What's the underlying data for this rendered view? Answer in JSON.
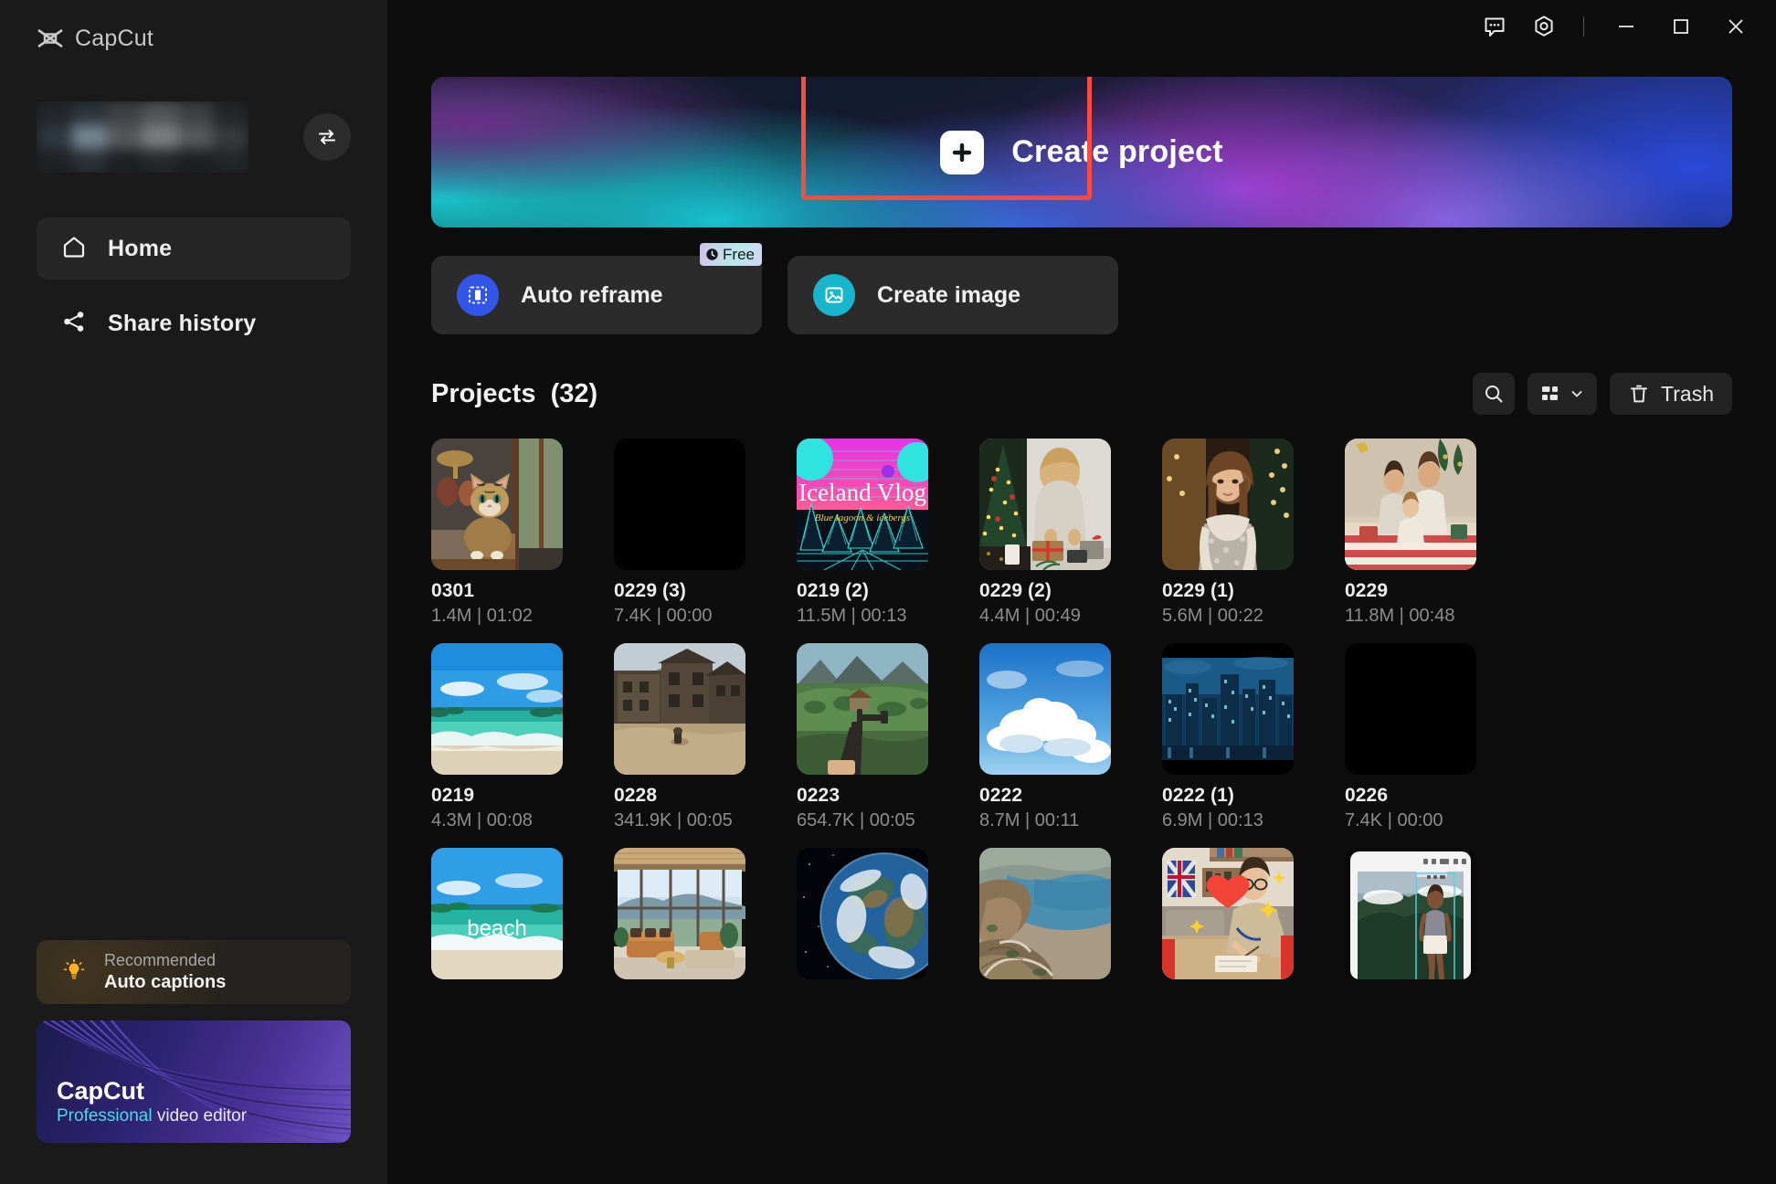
{
  "app": {
    "name": "CapCut"
  },
  "titlebar": {
    "feedback_icon": "speech-bubble-icon",
    "settings_icon": "gear-icon",
    "minimize_icon": "minimize-icon",
    "maximize_icon": "maximize-icon",
    "close_icon": "close-icon"
  },
  "sidebar": {
    "account": {
      "name_masked": "",
      "switch_icon": "switch-account-icon"
    },
    "nav": [
      {
        "label": "Home",
        "icon": "home-icon",
        "active": true
      },
      {
        "label": "Share history",
        "icon": "share-icon",
        "active": false
      }
    ],
    "recommended": {
      "icon": "lightbulb-icon",
      "subtitle": "Recommended",
      "title": "Auto captions"
    },
    "promo": {
      "title": "CapCut",
      "subtitle_accent": "Professional",
      "subtitle_rest": " video editor"
    }
  },
  "banner": {
    "create_label": "Create project",
    "plus_icon": "plus-icon",
    "highlight_color": "#fb4a3f"
  },
  "actions": [
    {
      "label": "Auto reframe",
      "icon": "auto-reframe-icon",
      "icon_color": "#3355e8",
      "badge": {
        "text": "Free",
        "icon": "clock-icon"
      }
    },
    {
      "label": "Create image",
      "icon": "image-icon",
      "icon_color": "#17b6cc",
      "badge": null
    }
  ],
  "projects_section": {
    "title": "Projects",
    "count": "(32)",
    "toolbar": {
      "search_icon": "search-icon",
      "view_icon": "grid-view-icon",
      "view_chevron_icon": "chevron-down-icon",
      "trash_icon": "trash-icon",
      "trash_label": "Trash"
    }
  },
  "projects": [
    {
      "title": "0301",
      "meta": "1.4M | 01:02",
      "thumb": "cat-window"
    },
    {
      "title": "0229 (3)",
      "meta": "7.4K | 00:00",
      "thumb": "black"
    },
    {
      "title": "0219 (2)",
      "meta": "11.5M | 00:13",
      "thumb": "iceland-vlog",
      "thumb_text": "Iceland Vlog",
      "thumb_subtext": "Blue lagoon & icebergs"
    },
    {
      "title": "0229 (2)",
      "meta": "4.4M | 00:49",
      "thumb": "christmas-gift-wrap"
    },
    {
      "title": "0229 (1)",
      "meta": "5.6M | 00:22",
      "thumb": "woman-christmas-lights"
    },
    {
      "title": "0229",
      "meta": "11.8M | 00:48",
      "thumb": "family-christmas"
    },
    {
      "title": "0219",
      "meta": "4.3M | 00:08",
      "thumb": "beach-sunny"
    },
    {
      "title": "0228",
      "meta": "341.9K | 00:05",
      "thumb": "game-village"
    },
    {
      "title": "0223",
      "meta": "654.7K | 00:05",
      "thumb": "game-valley-gun"
    },
    {
      "title": "0222",
      "meta": "8.7M | 00:11",
      "thumb": "clouds-sky"
    },
    {
      "title": "0222 (1)",
      "meta": "6.9M | 00:13",
      "thumb": "city-skyline"
    },
    {
      "title": "0226",
      "meta": "7.4K | 00:00",
      "thumb": "black"
    },
    {
      "title": "",
      "meta": "",
      "thumb": "beach-text",
      "thumb_text": "beach",
      "clipped": true
    },
    {
      "title": "",
      "meta": "",
      "thumb": "living-room",
      "clipped": true
    },
    {
      "title": "",
      "meta": "",
      "thumb": "earth-space",
      "clipped": true
    },
    {
      "title": "",
      "meta": "",
      "thumb": "coast-road",
      "clipped": true
    },
    {
      "title": "",
      "meta": "",
      "thumb": "woman-desk-heart",
      "clipped": true
    },
    {
      "title": "",
      "meta": "",
      "thumb": "editor-preview",
      "clipped": true
    }
  ]
}
